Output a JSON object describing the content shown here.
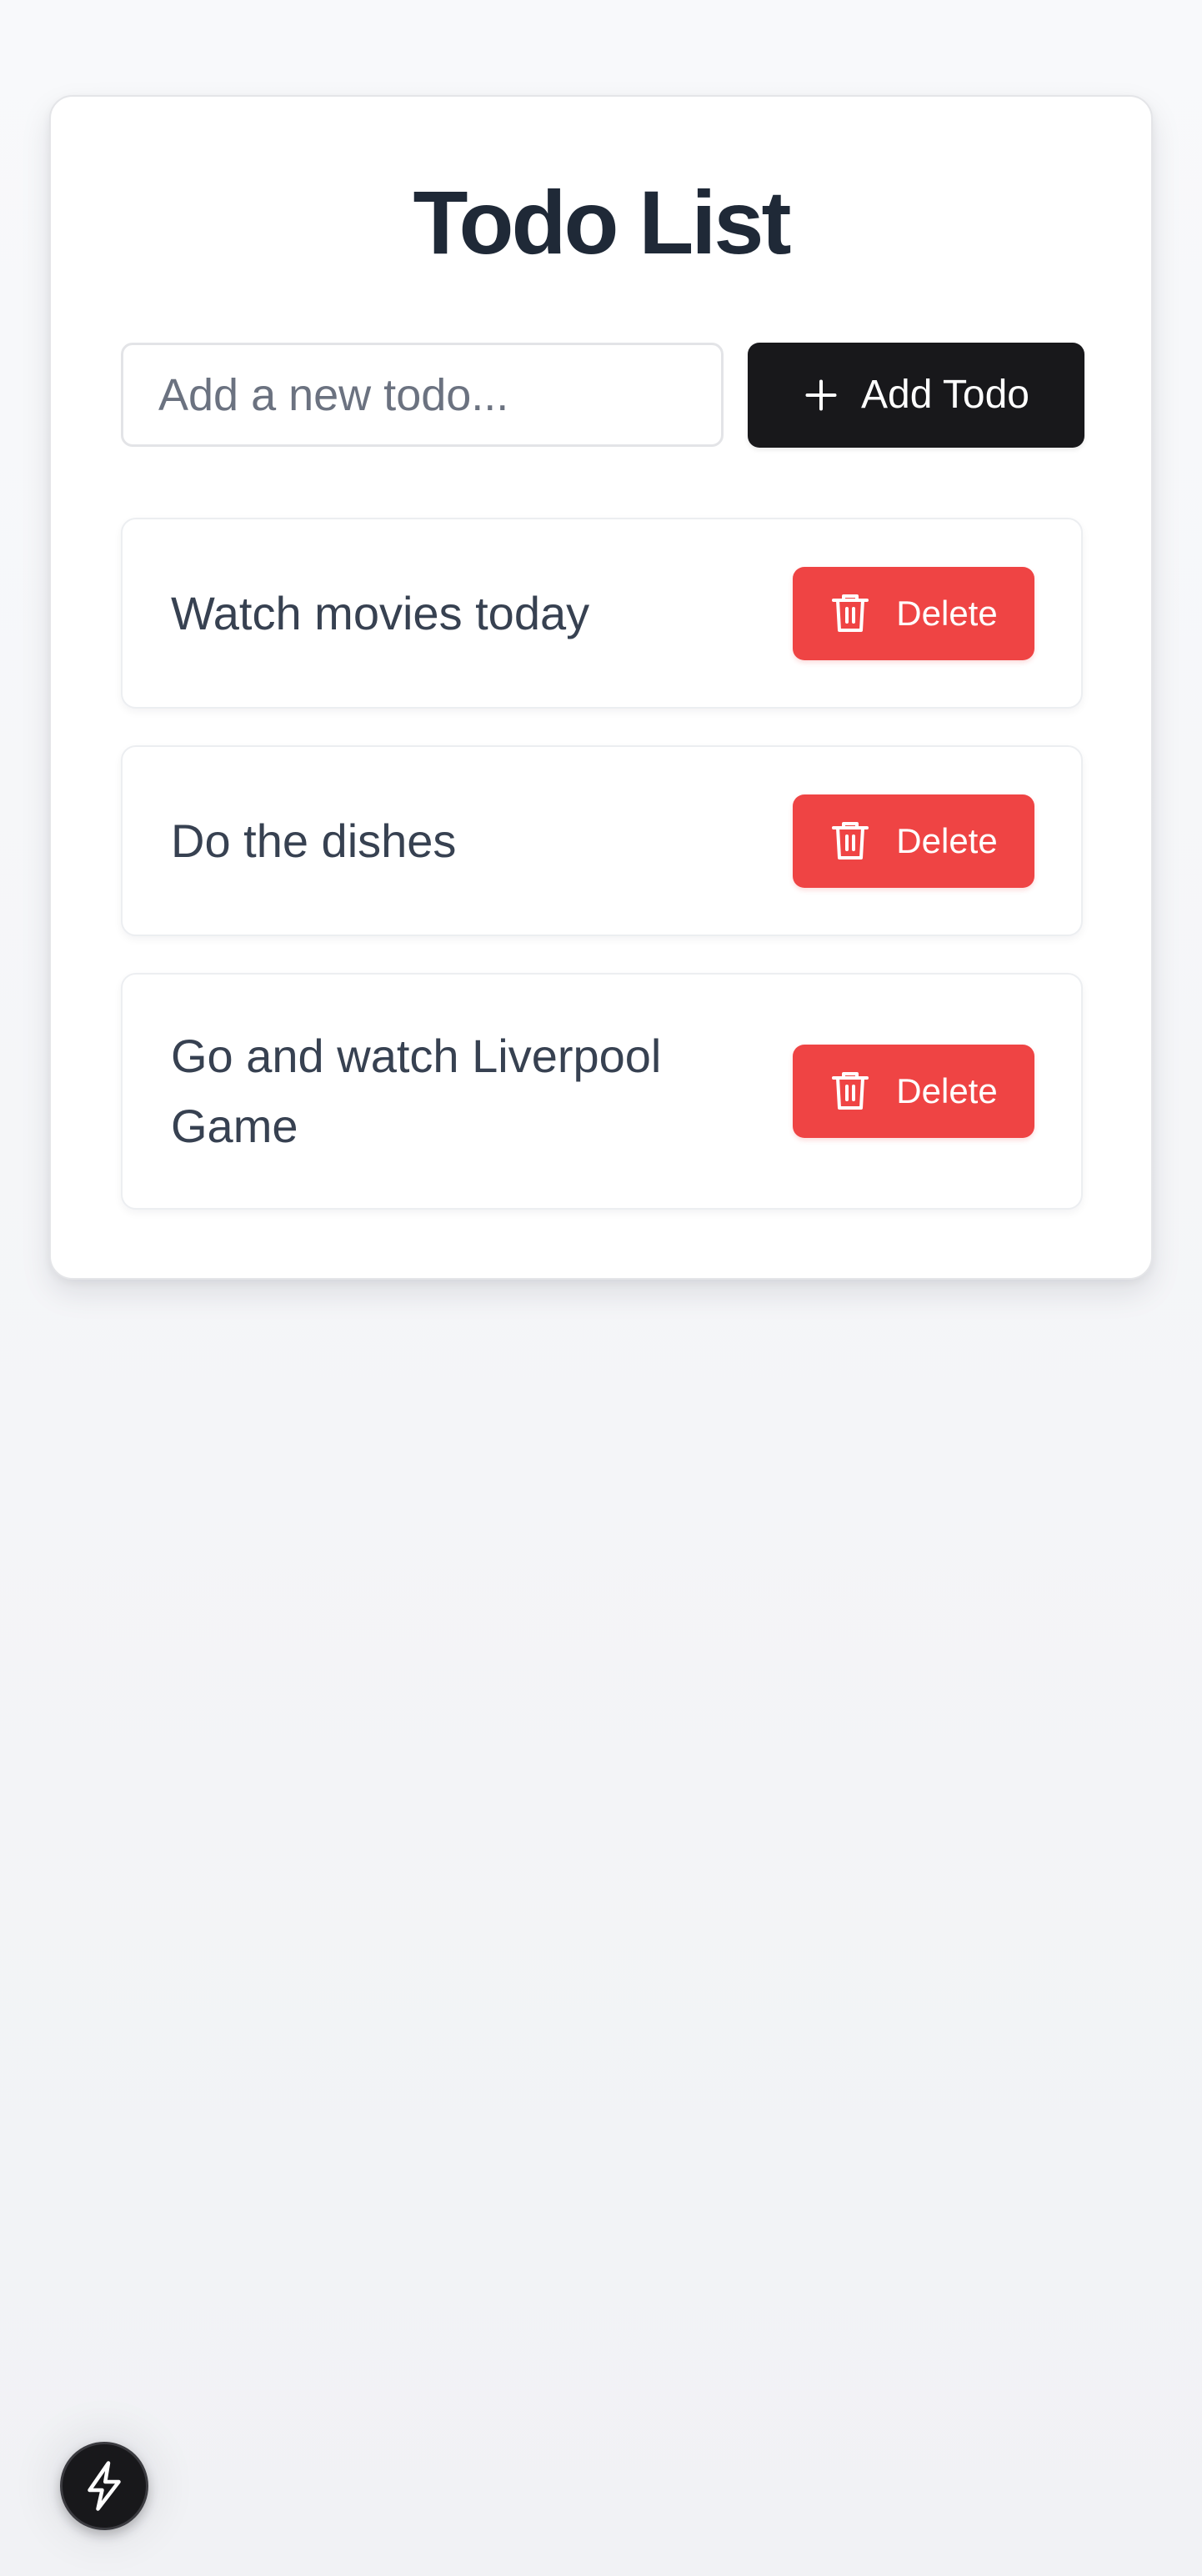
{
  "app": {
    "title": "Todo List"
  },
  "form": {
    "input_value": "",
    "input_placeholder": "Add a new todo...",
    "add_button_label": "Add Todo",
    "add_button_icon": "plus-icon"
  },
  "todos": [
    {
      "text": "Watch movies today",
      "delete_label": "Delete",
      "delete_icon": "trash-icon"
    },
    {
      "text": "Do the dishes",
      "delete_label": "Delete",
      "delete_icon": "trash-icon"
    },
    {
      "text": "Go and watch Liverpool Game",
      "delete_label": "Delete",
      "delete_icon": "trash-icon"
    }
  ],
  "floating_action": {
    "icon": "bolt-icon"
  },
  "colors": {
    "primary_button": "#18181b",
    "danger_button": "#ef4444",
    "title_text": "#1f2937",
    "body_text": "#374151",
    "page_background": "#f3f4f6",
    "card_background": "#ffffff"
  }
}
